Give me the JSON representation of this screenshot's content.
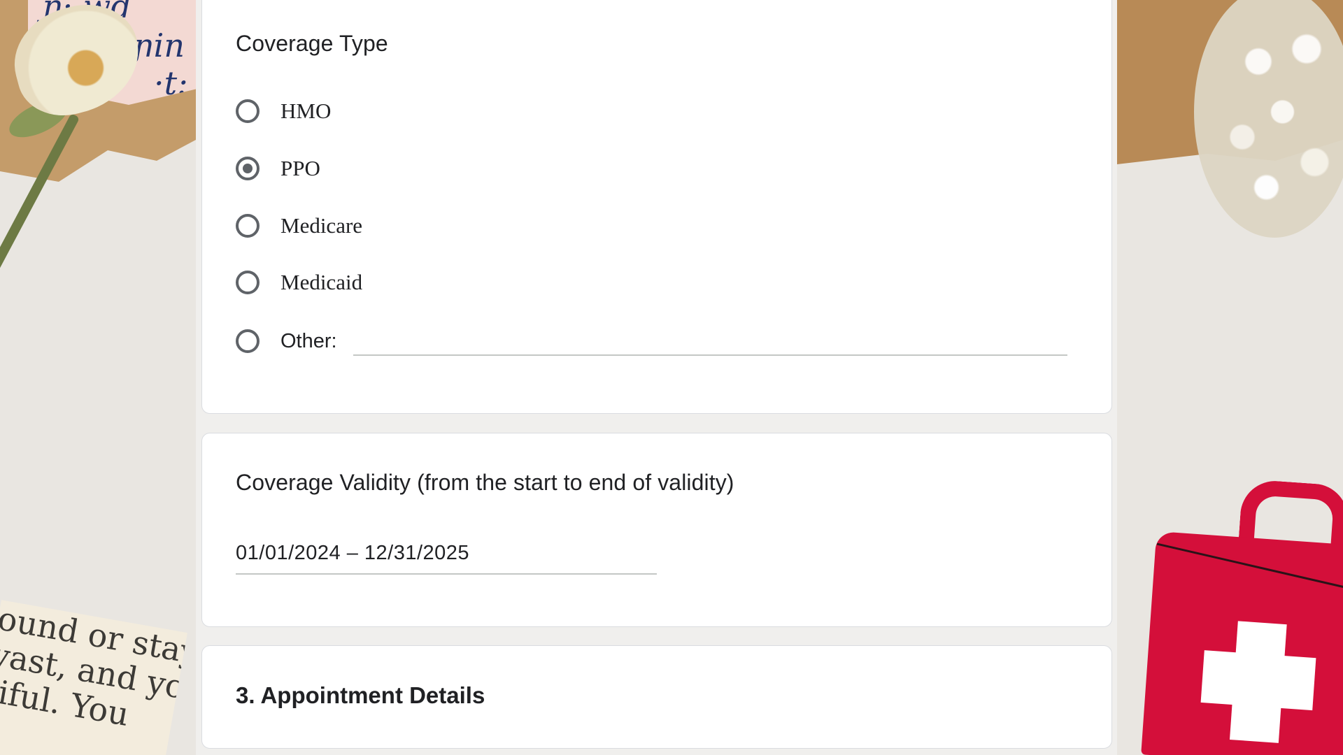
{
  "coverage_type": {
    "title": "Coverage Type",
    "options": [
      {
        "label": "HMO",
        "selected": false
      },
      {
        "label": "PPO",
        "selected": true
      },
      {
        "label": "Medicare",
        "selected": false
      },
      {
        "label": "Medicaid",
        "selected": false
      },
      {
        "label": "Other:",
        "selected": false
      }
    ],
    "other_value": ""
  },
  "coverage_validity": {
    "title": "Coverage Validity (from the start to end of validity)",
    "value": "01/01/2024 – 12/31/2025"
  },
  "section": {
    "title": "3. Appointment Details"
  },
  "decor": {
    "note_lines": [
      "ound or stays",
      "vast, and you",
      "tiful. You"
    ],
    "letter_glyphs": [
      "ɲ·  wd",
      "ɲin",
      "·t:"
    ]
  },
  "colors": {
    "radio": "#5f6368",
    "text": "#202124",
    "card_border": "#dadce0",
    "kit_red": "#d40f3a"
  }
}
